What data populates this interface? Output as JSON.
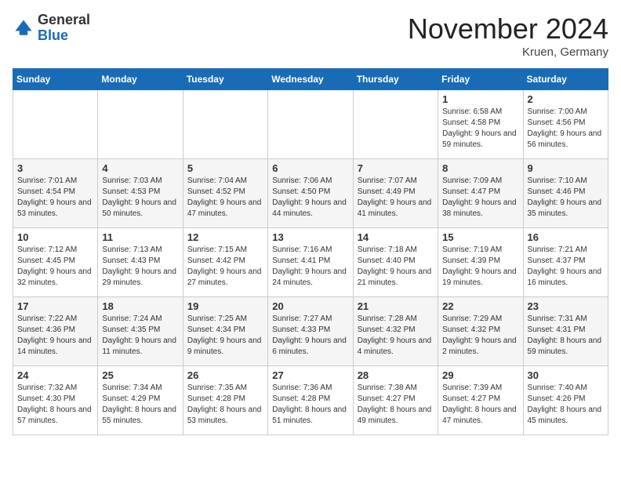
{
  "header": {
    "logo_general": "General",
    "logo_blue": "Blue",
    "month_title": "November 2024",
    "subtitle": "Kruen, Germany"
  },
  "weekdays": [
    "Sunday",
    "Monday",
    "Tuesday",
    "Wednesday",
    "Thursday",
    "Friday",
    "Saturday"
  ],
  "weeks": [
    [
      {
        "day": "",
        "info": ""
      },
      {
        "day": "",
        "info": ""
      },
      {
        "day": "",
        "info": ""
      },
      {
        "day": "",
        "info": ""
      },
      {
        "day": "",
        "info": ""
      },
      {
        "day": "1",
        "info": "Sunrise: 6:58 AM\nSunset: 4:58 PM\nDaylight: 9 hours and 59 minutes."
      },
      {
        "day": "2",
        "info": "Sunrise: 7:00 AM\nSunset: 4:56 PM\nDaylight: 9 hours and 56 minutes."
      }
    ],
    [
      {
        "day": "3",
        "info": "Sunrise: 7:01 AM\nSunset: 4:54 PM\nDaylight: 9 hours and 53 minutes."
      },
      {
        "day": "4",
        "info": "Sunrise: 7:03 AM\nSunset: 4:53 PM\nDaylight: 9 hours and 50 minutes."
      },
      {
        "day": "5",
        "info": "Sunrise: 7:04 AM\nSunset: 4:52 PM\nDaylight: 9 hours and 47 minutes."
      },
      {
        "day": "6",
        "info": "Sunrise: 7:06 AM\nSunset: 4:50 PM\nDaylight: 9 hours and 44 minutes."
      },
      {
        "day": "7",
        "info": "Sunrise: 7:07 AM\nSunset: 4:49 PM\nDaylight: 9 hours and 41 minutes."
      },
      {
        "day": "8",
        "info": "Sunrise: 7:09 AM\nSunset: 4:47 PM\nDaylight: 9 hours and 38 minutes."
      },
      {
        "day": "9",
        "info": "Sunrise: 7:10 AM\nSunset: 4:46 PM\nDaylight: 9 hours and 35 minutes."
      }
    ],
    [
      {
        "day": "10",
        "info": "Sunrise: 7:12 AM\nSunset: 4:45 PM\nDaylight: 9 hours and 32 minutes."
      },
      {
        "day": "11",
        "info": "Sunrise: 7:13 AM\nSunset: 4:43 PM\nDaylight: 9 hours and 29 minutes."
      },
      {
        "day": "12",
        "info": "Sunrise: 7:15 AM\nSunset: 4:42 PM\nDaylight: 9 hours and 27 minutes."
      },
      {
        "day": "13",
        "info": "Sunrise: 7:16 AM\nSunset: 4:41 PM\nDaylight: 9 hours and 24 minutes."
      },
      {
        "day": "14",
        "info": "Sunrise: 7:18 AM\nSunset: 4:40 PM\nDaylight: 9 hours and 21 minutes."
      },
      {
        "day": "15",
        "info": "Sunrise: 7:19 AM\nSunset: 4:39 PM\nDaylight: 9 hours and 19 minutes."
      },
      {
        "day": "16",
        "info": "Sunrise: 7:21 AM\nSunset: 4:37 PM\nDaylight: 9 hours and 16 minutes."
      }
    ],
    [
      {
        "day": "17",
        "info": "Sunrise: 7:22 AM\nSunset: 4:36 PM\nDaylight: 9 hours and 14 minutes."
      },
      {
        "day": "18",
        "info": "Sunrise: 7:24 AM\nSunset: 4:35 PM\nDaylight: 9 hours and 11 minutes."
      },
      {
        "day": "19",
        "info": "Sunrise: 7:25 AM\nSunset: 4:34 PM\nDaylight: 9 hours and 9 minutes."
      },
      {
        "day": "20",
        "info": "Sunrise: 7:27 AM\nSunset: 4:33 PM\nDaylight: 9 hours and 6 minutes."
      },
      {
        "day": "21",
        "info": "Sunrise: 7:28 AM\nSunset: 4:32 PM\nDaylight: 9 hours and 4 minutes."
      },
      {
        "day": "22",
        "info": "Sunrise: 7:29 AM\nSunset: 4:32 PM\nDaylight: 9 hours and 2 minutes."
      },
      {
        "day": "23",
        "info": "Sunrise: 7:31 AM\nSunset: 4:31 PM\nDaylight: 8 hours and 59 minutes."
      }
    ],
    [
      {
        "day": "24",
        "info": "Sunrise: 7:32 AM\nSunset: 4:30 PM\nDaylight: 8 hours and 57 minutes."
      },
      {
        "day": "25",
        "info": "Sunrise: 7:34 AM\nSunset: 4:29 PM\nDaylight: 8 hours and 55 minutes."
      },
      {
        "day": "26",
        "info": "Sunrise: 7:35 AM\nSunset: 4:28 PM\nDaylight: 8 hours and 53 minutes."
      },
      {
        "day": "27",
        "info": "Sunrise: 7:36 AM\nSunset: 4:28 PM\nDaylight: 8 hours and 51 minutes."
      },
      {
        "day": "28",
        "info": "Sunrise: 7:38 AM\nSunset: 4:27 PM\nDaylight: 8 hours and 49 minutes."
      },
      {
        "day": "29",
        "info": "Sunrise: 7:39 AM\nSunset: 4:27 PM\nDaylight: 8 hours and 47 minutes."
      },
      {
        "day": "30",
        "info": "Sunrise: 7:40 AM\nSunset: 4:26 PM\nDaylight: 8 hours and 45 minutes."
      }
    ]
  ]
}
